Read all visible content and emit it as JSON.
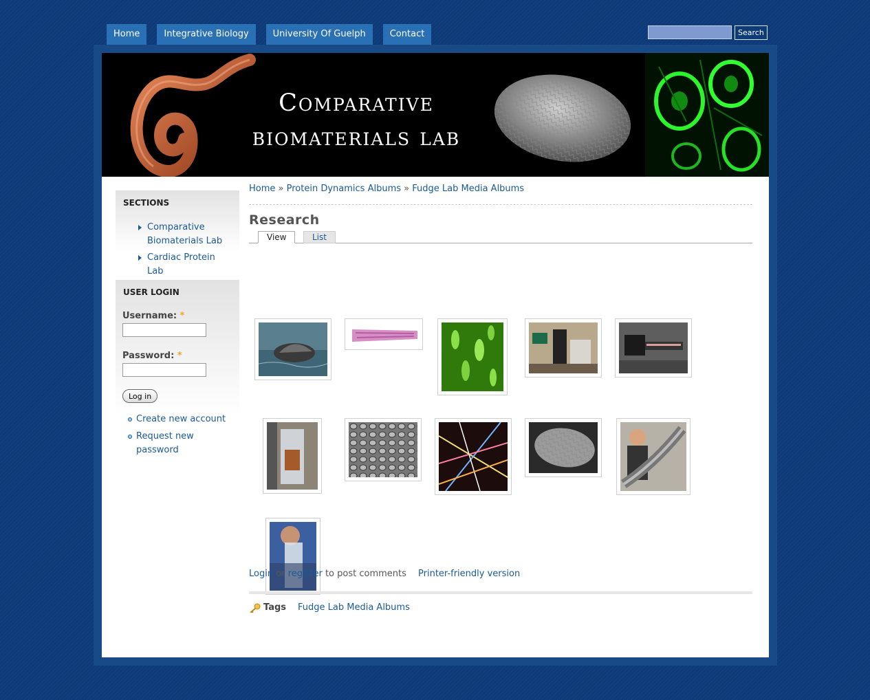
{
  "nav": {
    "tabs": [
      "Home",
      "Integrative Biology",
      "University Of Guelph",
      "Contact"
    ]
  },
  "search": {
    "button_label": "Search",
    "placeholder": ""
  },
  "banner": {
    "title_line1": "Comparative",
    "title_line2": "biomaterials lab"
  },
  "sidebar": {
    "sections_title": "SECTIONS",
    "sections": [
      "Comparative Biomaterials Lab",
      "Cardiac Protein Lab"
    ],
    "login_title": "USER LOGIN",
    "username_label": "Username:",
    "password_label": "Password:",
    "required_mark": "*",
    "login_button": "Log in",
    "links": [
      "Create new account",
      "Request new password"
    ]
  },
  "breadcrumb": {
    "items": [
      "Home",
      "Protein Dynamics Albums",
      "Fudge Lab Media Albums"
    ],
    "separator": "»"
  },
  "page_title": "Research",
  "tabs": {
    "view": "View",
    "list": "List"
  },
  "gallery": [
    {
      "name": "whale photo"
    },
    {
      "name": "pink tissue section"
    },
    {
      "name": "green fluorescence"
    },
    {
      "name": "lab microscope"
    },
    {
      "name": "test instrument"
    },
    {
      "name": "lab apparatus"
    },
    {
      "name": "cell texture micrograph"
    },
    {
      "name": "polarized fibers"
    },
    {
      "name": "grey egg micrograph"
    },
    {
      "name": "person with hagfish"
    },
    {
      "name": "person with beaker"
    }
  ],
  "post": {
    "login": "Login",
    "or": "or",
    "register": "register",
    "to_post": "to post comments",
    "printer": "Printer-friendly version"
  },
  "tags": {
    "label": "Tags",
    "link": "Fudge Lab Media Albums"
  },
  "colors": {
    "background": "#0d3a78",
    "nav_tab": "#2a70b4",
    "link": "#1a5a96",
    "frame": "#174a86"
  }
}
